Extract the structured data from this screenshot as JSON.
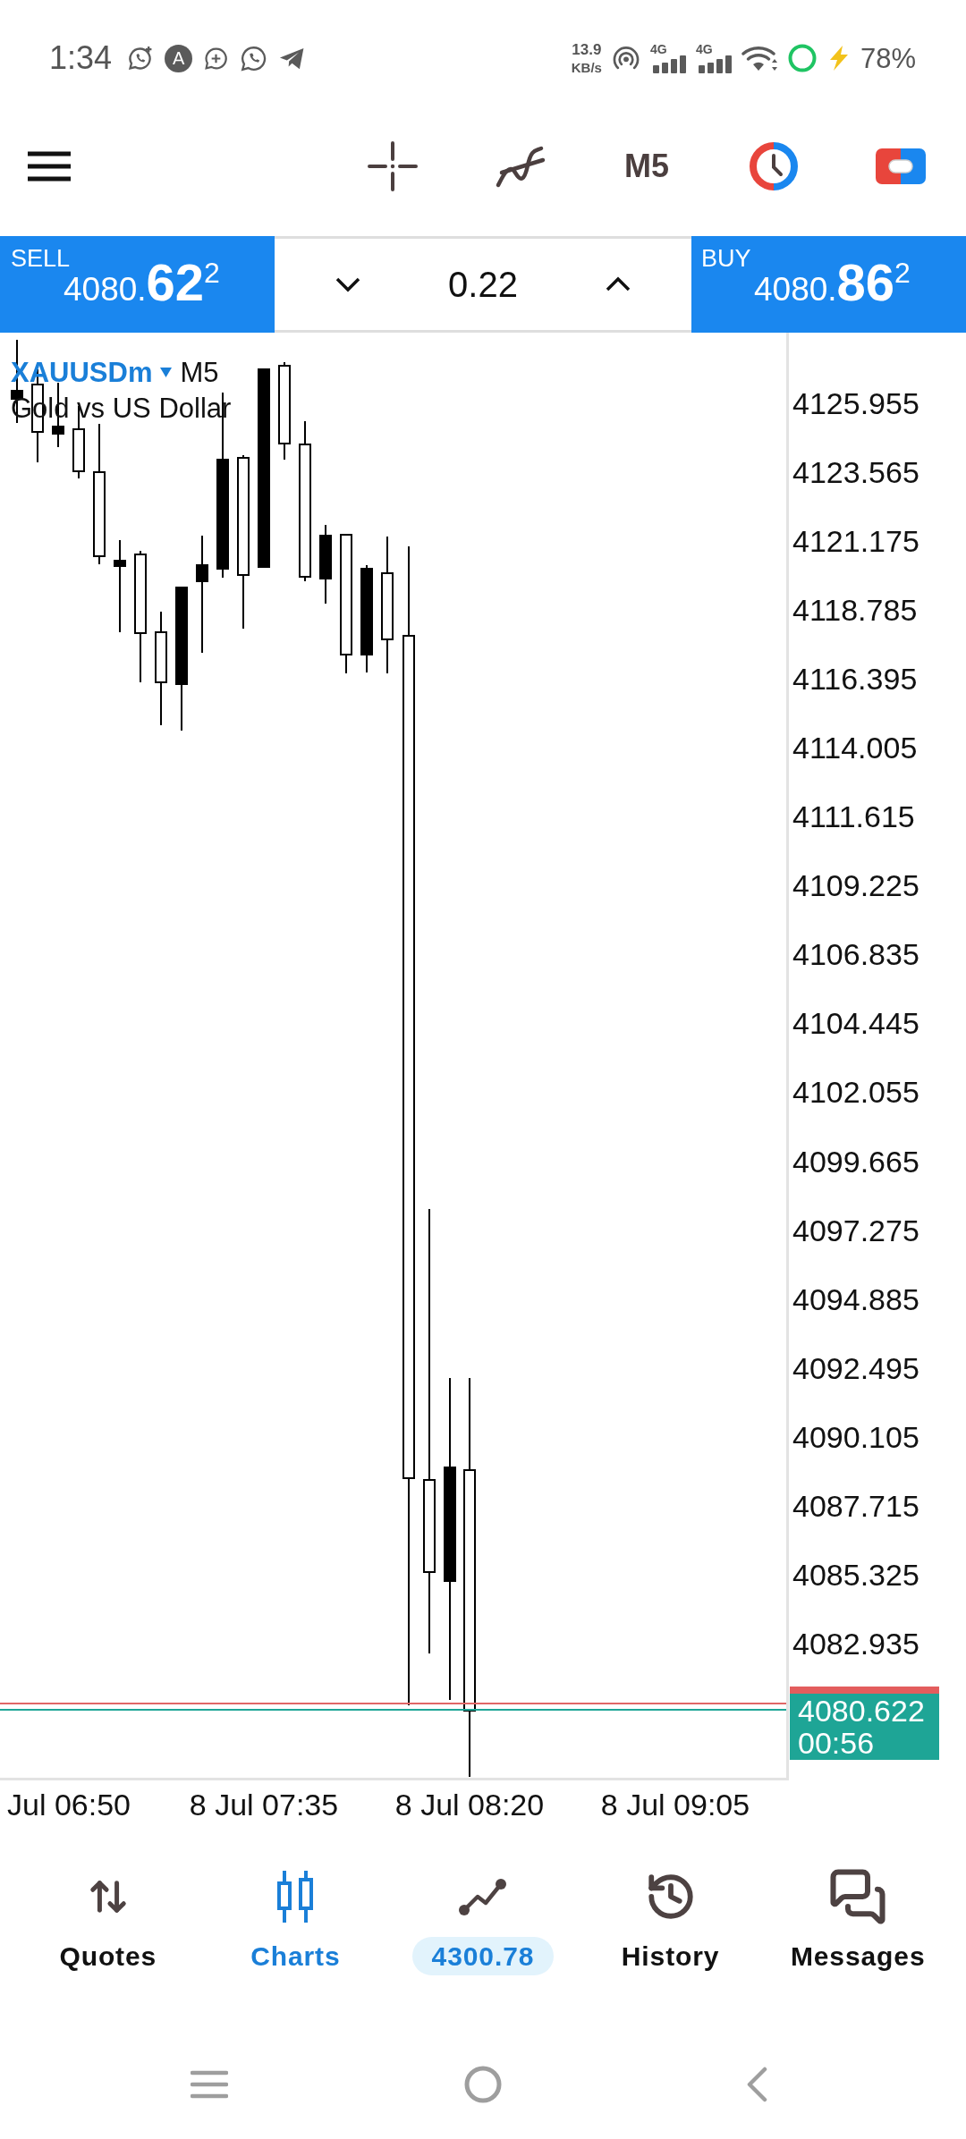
{
  "status_bar": {
    "time": "1:34",
    "app_logo_letter": "A",
    "net_speed": {
      "value": "13.9",
      "unit": "KB/s"
    },
    "signals": [
      {
        "network": "4G"
      },
      {
        "network": "4G"
      }
    ],
    "battery": "78%"
  },
  "toolbar": {
    "timeframe": "M5"
  },
  "trade_panel": {
    "sell": {
      "label": "SELL",
      "price": {
        "lead": "4080.",
        "big": "62",
        "sup": "2"
      }
    },
    "volume": "0.22",
    "buy": {
      "label": "BUY",
      "price": {
        "lead": "4080.",
        "big": "86",
        "sup": "2"
      }
    }
  },
  "chart": {
    "symbol": "XAUUSDm",
    "timeframe": "M5",
    "description": "Gold vs US Dollar",
    "price_labels": [
      "4125.955",
      "4123.565",
      "4121.175",
      "4118.785",
      "4116.395",
      "4114.005",
      "4111.615",
      "4109.225",
      "4106.835",
      "4104.445",
      "4102.055",
      "4099.665",
      "4097.275",
      "4094.885",
      "4092.495",
      "4090.105",
      "4087.715",
      "4085.325",
      "4082.935"
    ],
    "time_labels": [
      "Jul 06:50",
      "8 Jul 07:35",
      "8 Jul 08:20",
      "8 Jul 09:05"
    ],
    "bid_label": {
      "price": "4080.622",
      "countdown": "00:56"
    }
  },
  "bottom_nav": [
    {
      "kind": "tab",
      "label": "Quotes",
      "selected": false
    },
    {
      "kind": "tab",
      "label": "Charts",
      "selected": true
    },
    {
      "kind": "balance",
      "label": "4300.78",
      "selected": false
    },
    {
      "kind": "tab",
      "label": "History",
      "selected": false
    },
    {
      "kind": "tab",
      "label": "Messages",
      "selected": false
    }
  ]
}
